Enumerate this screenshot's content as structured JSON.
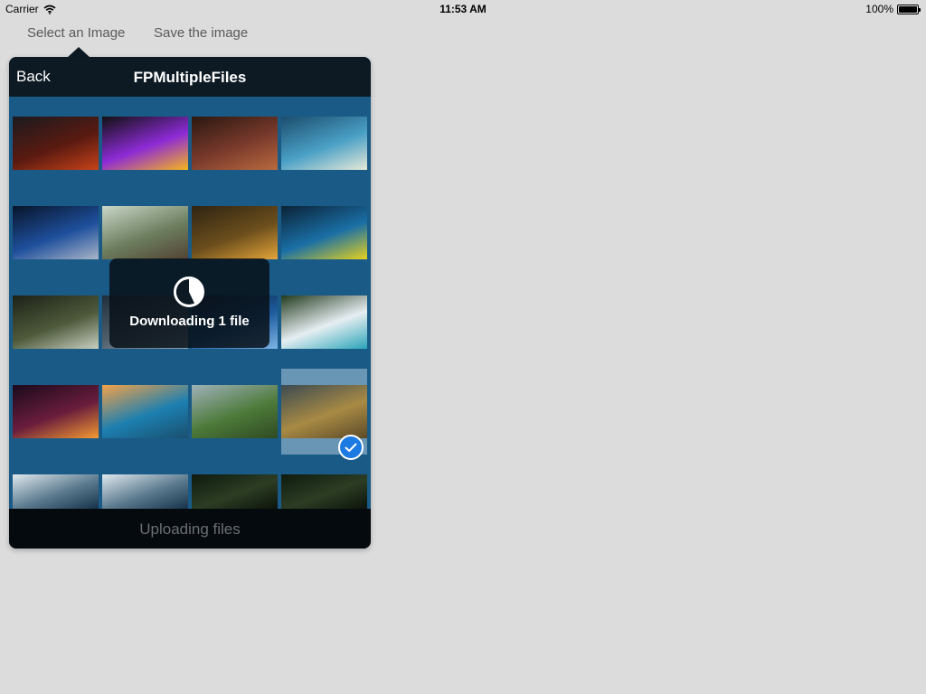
{
  "status_bar": {
    "carrier": "Carrier",
    "time": "11:53 AM",
    "battery": "100%"
  },
  "toolbar": {
    "select_label": "Select an Image",
    "save_label": "Save the image"
  },
  "picker": {
    "back_label": "Back",
    "title": "FPMultipleFiles",
    "bottom_status": "Uploading files"
  },
  "hud": {
    "message": "Downloading 1 file"
  },
  "thumbnails": [
    {
      "name": "lava-rock-thumbnail",
      "colors": [
        "#1b1a1f",
        "#5a1a10",
        "#c7421a"
      ]
    },
    {
      "name": "rainbow-smoke-thumbnail",
      "colors": [
        "#111",
        "#8d2bd6",
        "#f6b51c"
      ]
    },
    {
      "name": "abstract-red-thumbnail",
      "colors": [
        "#2b1810",
        "#7a3a2c",
        "#b86a3e"
      ]
    },
    {
      "name": "fantasy-tree-thumbnail",
      "colors": [
        "#1b4d6d",
        "#4aa0c6",
        "#e6e9d8"
      ]
    },
    {
      "name": "space-planets-thumbnail",
      "colors": [
        "#08142a",
        "#1e4f9c",
        "#aab6c8"
      ]
    },
    {
      "name": "foggy-road-thumbnail",
      "colors": [
        "#c9d6c8",
        "#6c7e5e",
        "#524233"
      ]
    },
    {
      "name": "still-life-fruit-thumbnail",
      "colors": [
        "#2f2413",
        "#6b4e1c",
        "#e4a43a"
      ]
    },
    {
      "name": "yellow-flowers-thumbnail",
      "colors": [
        "#0b2236",
        "#1a6fa6",
        "#e6d21d"
      ]
    },
    {
      "name": "forest-stream-thumbnail",
      "colors": [
        "#1d2118",
        "#4d5a3a",
        "#c8cfc1"
      ]
    },
    {
      "name": "mountain-lake-thumbnail",
      "colors": [
        "#1e2e3a",
        "#50606c",
        "#90a3b1"
      ]
    },
    {
      "name": "blue-globe-thumbnail",
      "colors": [
        "#0a1c36",
        "#1e5c9e",
        "#7fb4e6"
      ]
    },
    {
      "name": "waterfall-thumbnail",
      "colors": [
        "#233b1e",
        "#e6eef2",
        "#2aa4b8"
      ]
    },
    {
      "name": "red-lights-bokeh-thumbnail",
      "colors": [
        "#1a0a1c",
        "#6a1d3c",
        "#f39a32"
      ]
    },
    {
      "name": "ocean-sunset-thumbnail",
      "colors": [
        "#f3a24a",
        "#1c7fb0",
        "#1a4f6e"
      ]
    },
    {
      "name": "green-valley-thumbnail",
      "colors": [
        "#9fb1b9",
        "#4d7a3a",
        "#2f4a22"
      ]
    },
    {
      "name": "lone-tree-thumbnail",
      "colors": [
        "#3b4a52",
        "#a88a44",
        "#5c4a28"
      ]
    },
    {
      "name": "ocean-storm-thumbnail-1",
      "colors": [
        "#dfe8ee",
        "#5b7a8e",
        "#16324a"
      ]
    },
    {
      "name": "ocean-storm-thumbnail-2",
      "colors": [
        "#dfe8ee",
        "#5b7a8e",
        "#16324a"
      ]
    },
    {
      "name": "dark-forest-thumbnail-1",
      "colors": [
        "#0e1a0e",
        "#2c3d24",
        "#0b130a"
      ]
    },
    {
      "name": "dark-forest-thumbnail-2",
      "colors": [
        "#0e1a0e",
        "#2c3d24",
        "#0b130a"
      ]
    }
  ],
  "selected_thumbnail": "lone-tree-thumbnail",
  "icons": {
    "wifi": "wifi-icon",
    "check": "checkmark-icon",
    "progress": "progress-pie-icon"
  }
}
